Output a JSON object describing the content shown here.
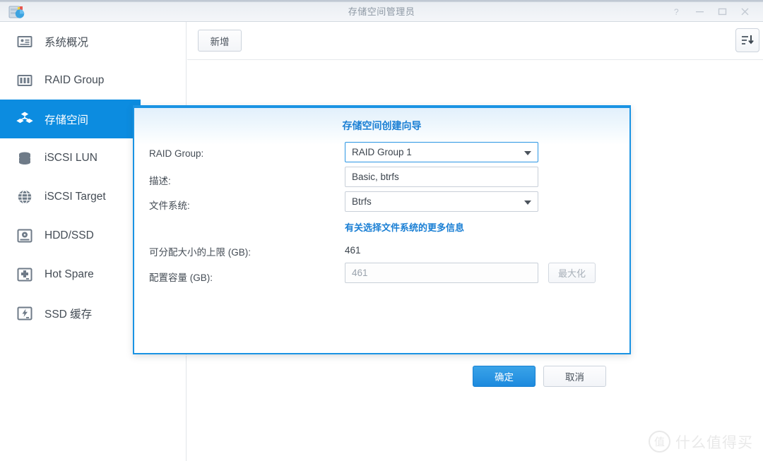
{
  "window": {
    "title": "存储空间管理员",
    "app_icon": "storage-manager-icon",
    "controls": [
      {
        "name": "help",
        "glyph": "?"
      },
      {
        "name": "minimize",
        "glyph": "–"
      },
      {
        "name": "maximize",
        "glyph": "□"
      },
      {
        "name": "close",
        "glyph": "✕"
      }
    ]
  },
  "sidebar": {
    "items": [
      {
        "label": "系统概况",
        "icon": "overview-card-icon",
        "active": false
      },
      {
        "label": "RAID Group",
        "icon": "raid-group-icon",
        "active": false
      },
      {
        "label": "存储空间",
        "icon": "storage-volume-icon",
        "active": true
      },
      {
        "label": "iSCSI LUN",
        "icon": "database-stack-icon",
        "active": false
      },
      {
        "label": "iSCSI Target",
        "icon": "globe-icon",
        "active": false
      },
      {
        "label": "HDD/SSD",
        "icon": "hard-disk-icon",
        "active": false
      },
      {
        "label": "Hot Spare",
        "icon": "disk-plus-icon",
        "active": false
      },
      {
        "label": "SSD 缓存",
        "icon": "disk-lightning-icon",
        "active": false
      }
    ]
  },
  "toolbar": {
    "add_label": "新增",
    "sort_icon": "sort-descending-icon"
  },
  "dialog": {
    "title": "存储空间创建向导",
    "fields": {
      "raid_group": {
        "label": "RAID Group:",
        "value": "RAID Group 1",
        "type": "select",
        "focused": true
      },
      "description": {
        "label": "描述:",
        "value": "Basic, btrfs",
        "type": "text"
      },
      "file_system": {
        "label": "文件系统:",
        "value": "Btrfs",
        "type": "select",
        "focused": false
      },
      "more_info_link": "有关选择文件系统的更多信息",
      "max_allocatable": {
        "label": "可分配大小的上限 (GB):",
        "value": "461"
      },
      "allocated_capacity": {
        "label": "配置容量 (GB):",
        "value": "461",
        "maximize_label": "最大化"
      }
    },
    "buttons": {
      "ok": "确定",
      "cancel": "取消"
    },
    "accent_color": "#1a93e3"
  },
  "watermark": {
    "mark": "值",
    "text": "什么值得买"
  },
  "colors": {
    "accent": "#0c8ce0",
    "link": "#1a7fd4",
    "titlebar_text": "#8d98a4"
  }
}
